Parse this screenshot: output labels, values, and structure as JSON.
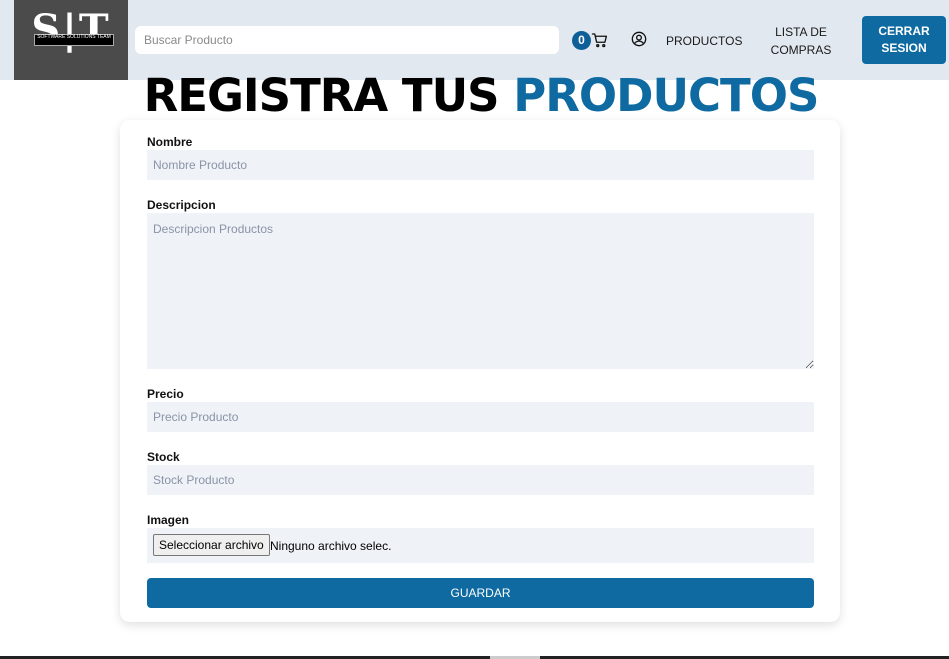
{
  "navbar": {
    "logo": {
      "initials": "S|T",
      "tagline": "SOFTWARE SOLUTIONS TEAM"
    },
    "search": {
      "placeholder": "Buscar Producto",
      "value": ""
    },
    "cart": {
      "count": "0",
      "icon": "cart-icon"
    },
    "user_icon": "user-circle-icon",
    "links": {
      "productos": "PRODUCTOS",
      "lista_compras": "LISTA DE COMPRAS"
    },
    "logout_label": "CERRAR SESION"
  },
  "page": {
    "title_main": "REGISTRA TUS",
    "title_accent": "PRODUCTOS",
    "accent_color": "#0e6aa1"
  },
  "form": {
    "nombre": {
      "label": "Nombre",
      "placeholder": "Nombre Producto",
      "value": ""
    },
    "descripcion": {
      "label": "Descripcion",
      "placeholder": "Descripcion Productos",
      "value": ""
    },
    "precio": {
      "label": "Precio",
      "placeholder": "Precio Producto",
      "value": ""
    },
    "stock": {
      "label": "Stock",
      "placeholder": "Stock Producto",
      "value": ""
    },
    "imagen": {
      "label": "Imagen",
      "button_label": "Seleccionar archivo",
      "status": "Ninguno archivo selec."
    },
    "submit_label": "GUARDAR"
  }
}
